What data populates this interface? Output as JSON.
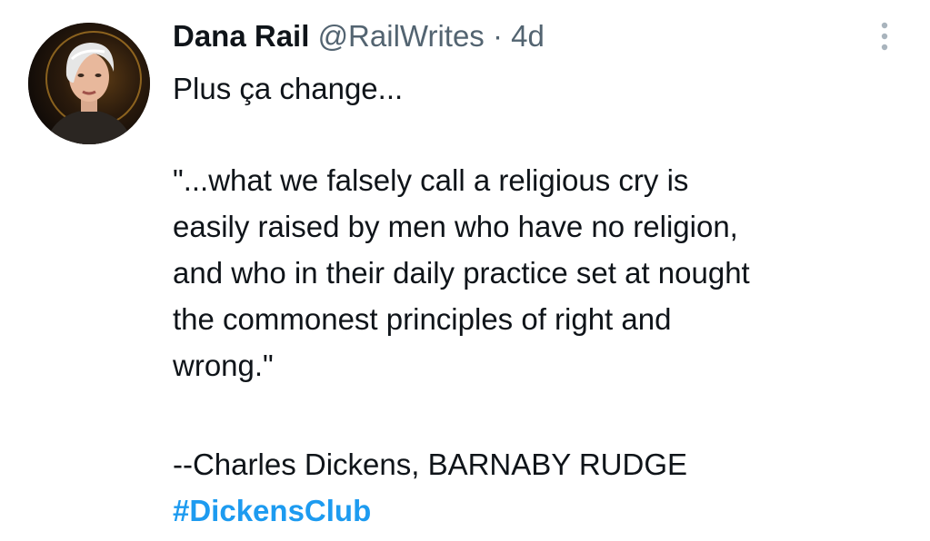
{
  "tweet": {
    "display_name": "Dana Rail",
    "handle": "@RailWrites",
    "separator": "·",
    "timestamp": "4d",
    "more_icon": "more-vertical-icon",
    "line1": "Plus ça change...",
    "quote_lines": [
      "\"...what we falsely call a religious cry is",
      "easily raised by men who have no religion,",
      "and who in their daily practice set at nought",
      "the commonest principles of right and",
      "wrong.\""
    ],
    "attribution": "--Charles Dickens, BARNABY RUDGE",
    "hashtag": "#DickensClub"
  },
  "colors": {
    "text": "#0f1419",
    "secondary": "#536471",
    "link": "#1d9bf0",
    "more_icon": "#a9b4bd"
  }
}
